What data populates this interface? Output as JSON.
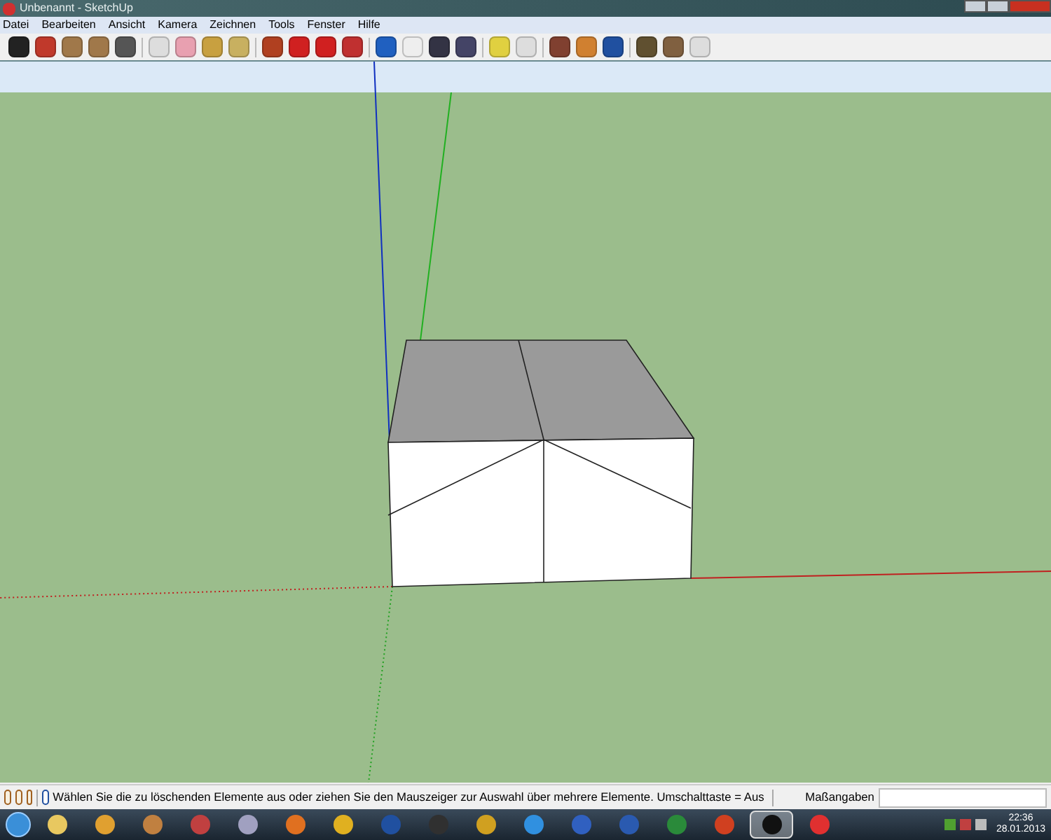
{
  "window": {
    "title": "Unbenannt - SketchUp"
  },
  "menu": [
    "Datei",
    "Bearbeiten",
    "Ansicht",
    "Kamera",
    "Zeichnen",
    "Tools",
    "Fenster",
    "Hilfe"
  ],
  "status_bar": {
    "message": "Wählen Sie die zu löschenden Elemente aus oder ziehen Sie den Mauszeiger zur Auswahl über mehrere Elemente. Umschalttaste = Aus",
    "measure_label": "Maßangaben"
  },
  "taskbar": {
    "buttons": [
      {
        "selected": false
      },
      {
        "selected": false
      },
      {
        "selected": false
      },
      {
        "selected": false
      },
      {
        "selected": false
      },
      {
        "selected": false
      },
      {
        "selected": false
      },
      {
        "selected": false
      },
      {
        "selected": false
      },
      {
        "selected": false
      },
      {
        "selected": false
      },
      {
        "selected": false
      },
      {
        "selected": false
      },
      {
        "selected": false
      },
      {
        "selected": false
      },
      {
        "selected": true
      },
      {
        "selected": false
      }
    ],
    "clock": {
      "time": "22:36",
      "date": "28.01.2013"
    }
  }
}
